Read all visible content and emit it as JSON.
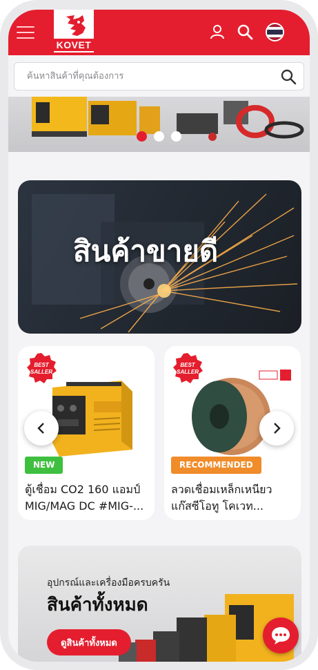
{
  "header": {
    "logo_text": "KOVET"
  },
  "search": {
    "placeholder": "ค้นหาสินค้าที่คุณต้องการ"
  },
  "hero": {
    "title": "สินค้าขายดี"
  },
  "products": [
    {
      "badge": "BEST SELLER",
      "tag": "NEW",
      "name": "ตู้เชื่อม CO2 160 แอมป์ MIG/MAG DC #MIG-..."
    },
    {
      "badge": "BEST SELLER",
      "tag": "RECOMMENDED",
      "name": "ลวดเชื่อมเหล็กเหนียว แก๊สซีโอทู โคเวท..."
    }
  ],
  "all_products": {
    "subtitle": "อุปกรณ์และเครื่องมือครบครัน",
    "title": "สินค้าทั้งหมด",
    "button": "ดูสินค้าทั้งหมด"
  },
  "colors": {
    "brand_red": "#e41e2e",
    "tag_new": "#3fbf3f",
    "tag_recommended": "#f08c2a"
  }
}
